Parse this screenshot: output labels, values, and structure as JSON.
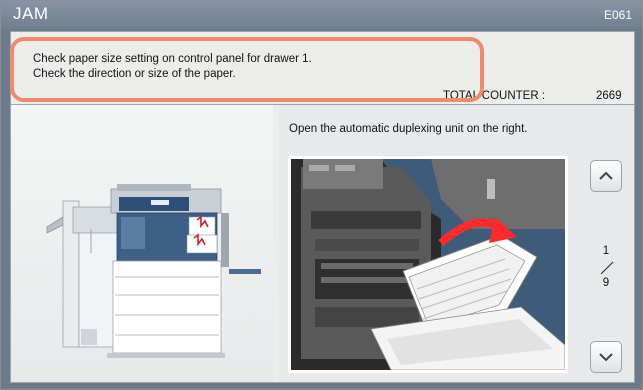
{
  "header": {
    "title": "JAM",
    "code": "E061"
  },
  "message": {
    "line1": "Check paper size setting on control panel for drawer 1.",
    "line2": "Check the direction or size of the paper.",
    "counter_label": "TOTAL COUNTER :",
    "counter_value": "2669"
  },
  "instruction": {
    "text": "Open the automatic duplexing unit on the right."
  },
  "pager": {
    "current": "1",
    "total": "9"
  },
  "colors": {
    "highlight": "#ef8a6c",
    "jam_indicator": "#d0202a",
    "background": "#6b7b8b"
  },
  "icons": {
    "up": "chevron-up-icon",
    "down": "chevron-down-icon",
    "jam_marks": "jam-indicator-icon"
  }
}
